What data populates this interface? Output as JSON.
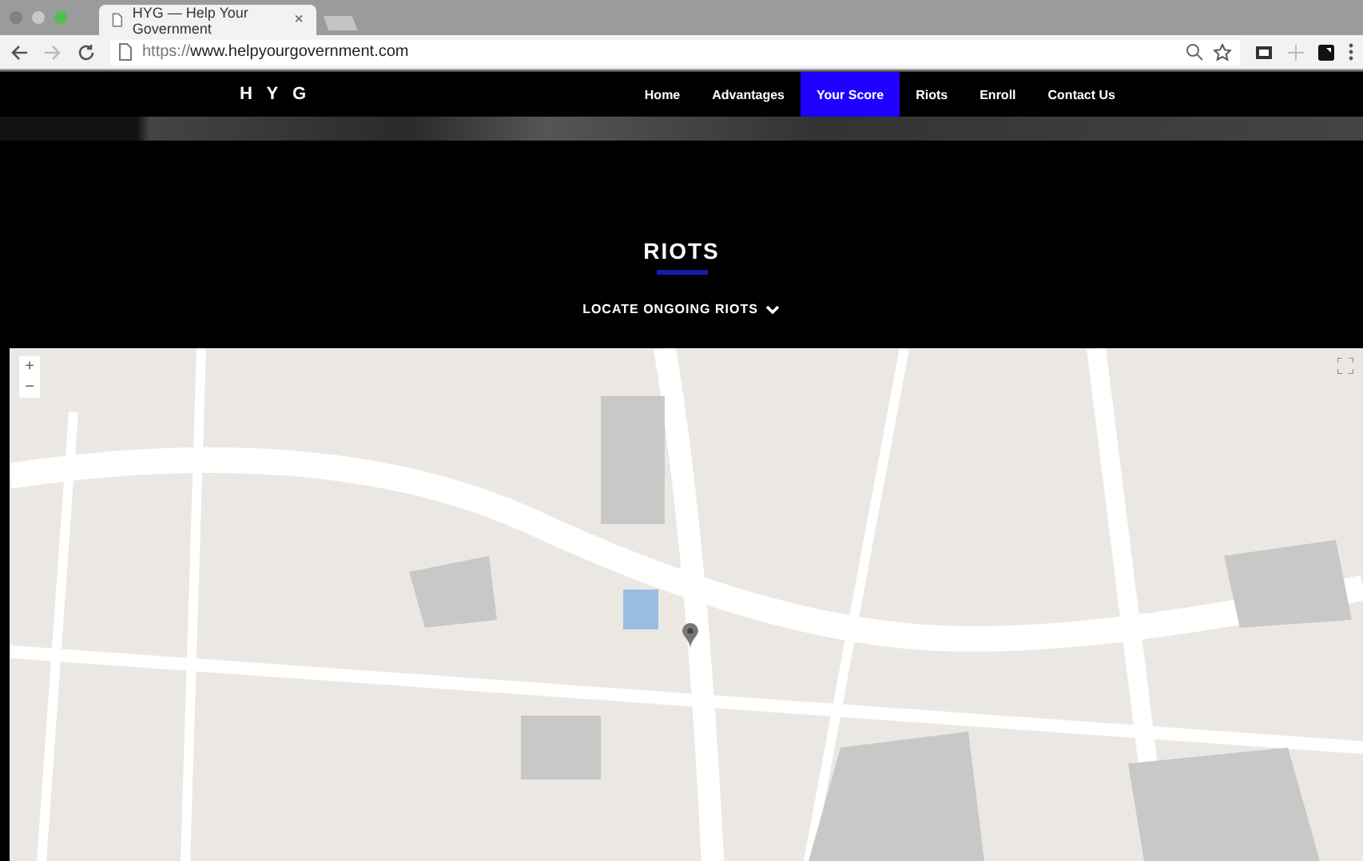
{
  "browser": {
    "tab_title": "HYG — Help Your Government",
    "tab_close": "×",
    "url_scheme": "https://",
    "url_host": "www.helpyourgovernment.com"
  },
  "nav": {
    "logo": "H Y G",
    "items": [
      {
        "label": "Home",
        "selected": false
      },
      {
        "label": "Advantages",
        "selected": false
      },
      {
        "label": "Your Score",
        "selected": true
      },
      {
        "label": "Riots",
        "selected": false
      },
      {
        "label": "Enroll",
        "selected": false
      },
      {
        "label": "Contact Us",
        "selected": false
      }
    ]
  },
  "section": {
    "title": "RIOTS",
    "toggle": "LOCATE ONGOING RIOTS"
  },
  "map": {
    "kind": "picture",
    "zoom_in": "+",
    "zoom_out": "−"
  }
}
